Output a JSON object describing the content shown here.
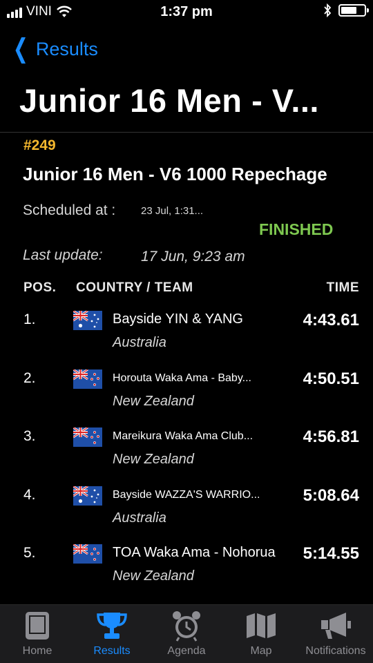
{
  "status_bar": {
    "carrier": "VINI",
    "time": "1:37 pm"
  },
  "nav": {
    "back_label": "Results",
    "title": "Junior 16 Men - V..."
  },
  "race": {
    "number": "#249",
    "title": "Junior 16 Men - V6 1000 Repechage",
    "scheduled_label": "Scheduled at :",
    "scheduled_value": "23 Jul, 1:31...",
    "status": "FINISHED",
    "last_update_label": "Last update:",
    "last_update_value": "17 Jun, 9:23 am"
  },
  "table": {
    "headers": {
      "pos": "POS.",
      "team": "COUNTRY / TEAM",
      "time": "TIME"
    },
    "rows": [
      {
        "pos": "1.",
        "team": "Bayside YIN & YANG",
        "country": "Australia",
        "time": "4:43.61",
        "flag": "australia-flag-icon"
      },
      {
        "pos": "2.",
        "team": "Horouta Waka Ama - Baby...",
        "country": "New Zealand",
        "time": "4:50.51",
        "flag": "new-zealand-flag-icon"
      },
      {
        "pos": "3.",
        "team": "Mareikura Waka Ama Club...",
        "country": "New Zealand",
        "time": "4:56.81",
        "flag": "new-zealand-flag-icon"
      },
      {
        "pos": "4.",
        "team": "Bayside WAZZA'S WARRIO...",
        "country": "Australia",
        "time": "5:08.64",
        "flag": "australia-flag-icon"
      },
      {
        "pos": "5.",
        "team": "TOA Waka Ama - Nohorua",
        "country": "New Zealand",
        "time": "5:14.55",
        "flag": "new-zealand-flag-icon"
      }
    ]
  },
  "tabs": [
    {
      "label": "Home",
      "icon": "home-icon"
    },
    {
      "label": "Results",
      "icon": "trophy-icon",
      "active": true
    },
    {
      "label": "Agenda",
      "icon": "alarm-clock-icon"
    },
    {
      "label": "Map",
      "icon": "map-icon"
    },
    {
      "label": "Notifications",
      "icon": "megaphone-icon"
    }
  ],
  "colors": {
    "accent": "#1a8cff",
    "race_number": "#f5b82e",
    "finished": "#7ec850",
    "tab_inactive": "#8e8e93"
  }
}
